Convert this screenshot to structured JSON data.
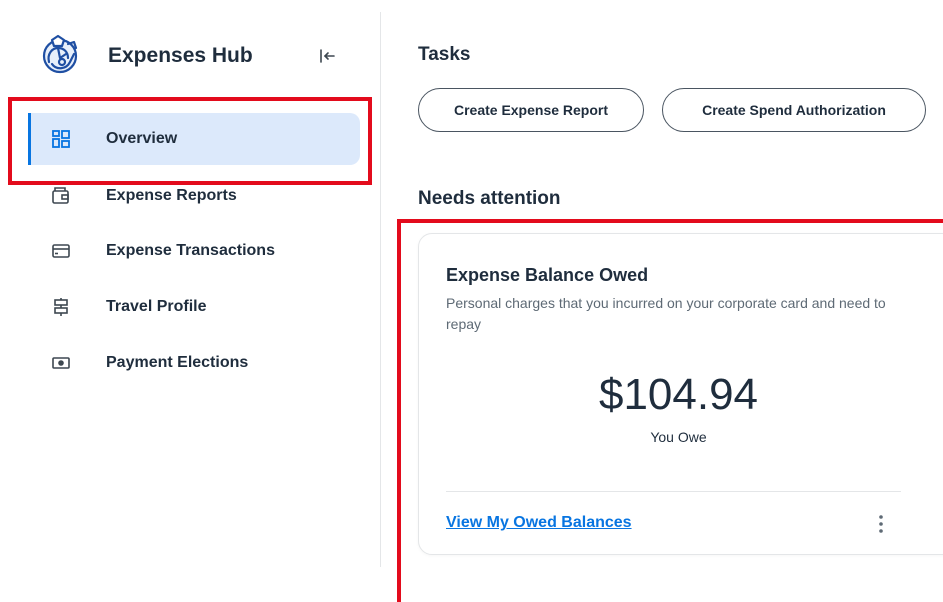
{
  "app": {
    "title": "Expenses Hub"
  },
  "sidebar": {
    "items": [
      {
        "label": "Overview",
        "icon": "overview-grid-icon",
        "active": true
      },
      {
        "label": "Expense Reports",
        "icon": "wallet-icon"
      },
      {
        "label": "Expense Transactions",
        "icon": "credit-card-icon"
      },
      {
        "label": "Travel Profile",
        "icon": "signpost-icon"
      },
      {
        "label": "Payment Elections",
        "icon": "banknote-icon"
      }
    ]
  },
  "tasks": {
    "heading": "Tasks",
    "buttons": [
      {
        "label": "Create Expense Report"
      },
      {
        "label": "Create Spend Authorization"
      }
    ]
  },
  "attention": {
    "heading": "Needs attention",
    "card": {
      "title": "Expense Balance Owed",
      "description": "Personal charges that you incurred on your corporate card and need to repay",
      "amount": "$104.94",
      "amount_label": "You Owe",
      "link": "View My Owed Balances"
    }
  },
  "colors": {
    "accent": "#0875e1",
    "active_bg": "#dce9fb",
    "annotation_red": "#e30b1c",
    "text": "#1f2d3d",
    "muted": "#5e6a75"
  }
}
